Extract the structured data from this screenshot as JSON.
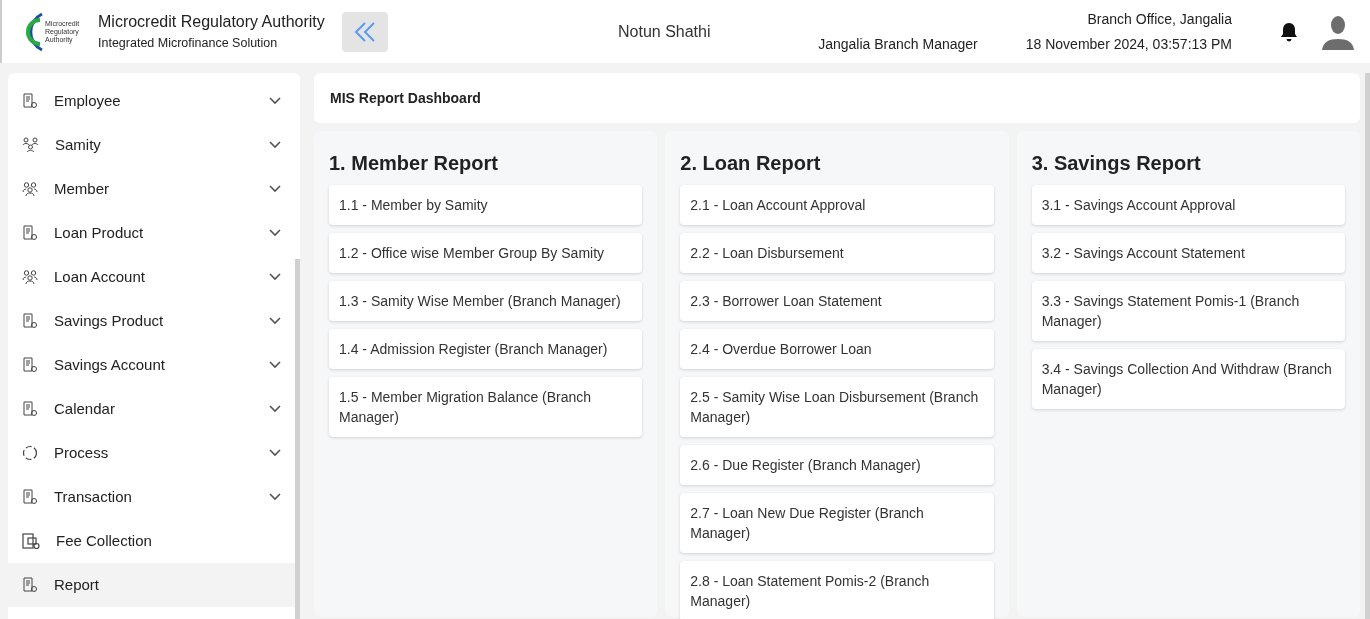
{
  "header": {
    "logo_text": [
      "Microcredit",
      "Regulatory",
      "Authority"
    ],
    "title": "Microcredit Regulatory Authority",
    "subtitle": "Integrated Microfinance Solution",
    "app_name": "Notun Shathi",
    "role": "Jangalia Branch Manager",
    "office": "Branch Office, Jangalia",
    "datetime": "18 November 2024, 03:57:13 PM"
  },
  "sidebar": {
    "items": [
      {
        "label": "Employee",
        "expandable": true,
        "selected": false
      },
      {
        "label": "Samity",
        "expandable": true,
        "selected": false
      },
      {
        "label": "Member",
        "expandable": true,
        "selected": false
      },
      {
        "label": "Loan Product",
        "expandable": true,
        "selected": false
      },
      {
        "label": "Loan Account",
        "expandable": true,
        "selected": false
      },
      {
        "label": "Savings Product",
        "expandable": true,
        "selected": false
      },
      {
        "label": "Savings Account",
        "expandable": true,
        "selected": false
      },
      {
        "label": "Calendar",
        "expandable": true,
        "selected": false
      },
      {
        "label": "Process",
        "expandable": true,
        "selected": false
      },
      {
        "label": "Transaction",
        "expandable": true,
        "selected": false
      },
      {
        "label": "Fee Collection",
        "expandable": false,
        "selected": false
      },
      {
        "label": "Report",
        "expandable": false,
        "selected": true
      }
    ]
  },
  "dashboard": {
    "title": "MIS Report Dashboard",
    "columns": [
      {
        "title": "1. Member Report",
        "reports": [
          "1.1 - Member by Samity",
          "1.2 - Office wise Member Group By Samity",
          "1.3 - Samity Wise Member (Branch Manager)",
          "1.4 - Admission Register (Branch Manager)",
          "1.5 - Member Migration Balance (Branch Manager)"
        ]
      },
      {
        "title": "2. Loan Report",
        "reports": [
          "2.1 - Loan Account Approval",
          "2.2 - Loan Disbursement",
          "2.3 - Borrower Loan Statement",
          "2.4 - Overdue Borrower Loan",
          "2.5 - Samity Wise Loan Disbursement (Branch Manager)",
          "2.6 - Due Register (Branch Manager)",
          "2.7 - Loan New Due Register (Branch Manager)",
          "2.8 - Loan Statement Pomis-2 (Branch Manager)"
        ]
      },
      {
        "title": "3. Savings Report",
        "reports": [
          "3.1 - Savings Account Approval",
          "3.2 - Savings Account Statement",
          "3.3 - Savings Statement Pomis-1 (Branch Manager)",
          "3.4 - Savings Collection And Withdraw (Branch Manager)"
        ]
      }
    ]
  }
}
